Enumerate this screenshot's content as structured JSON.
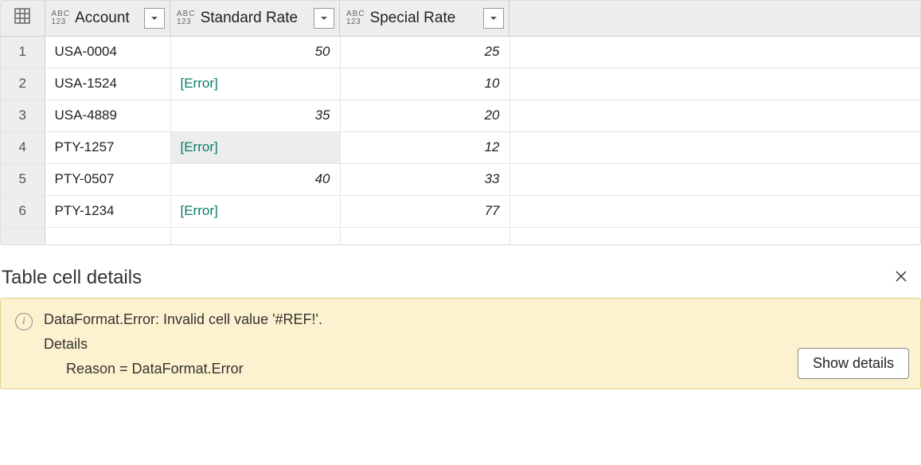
{
  "columns": {
    "c0": {
      "label": "Account",
      "type_top": "ABC",
      "type_bot": "123"
    },
    "c1": {
      "label": "Standard Rate",
      "type_top": "ABC",
      "type_bot": "123"
    },
    "c2": {
      "label": "Special Rate",
      "type_top": "ABC",
      "type_bot": "123"
    }
  },
  "rows": [
    {
      "n": "1",
      "account": "USA-0004",
      "std": "50",
      "std_err": false,
      "sp": "25"
    },
    {
      "n": "2",
      "account": "USA-1524",
      "std": "[Error]",
      "std_err": true,
      "sp": "10"
    },
    {
      "n": "3",
      "account": "USA-4889",
      "std": "35",
      "std_err": false,
      "sp": "20"
    },
    {
      "n": "4",
      "account": "PTY-1257",
      "std": "[Error]",
      "std_err": true,
      "sp": "12",
      "selected": true
    },
    {
      "n": "5",
      "account": "PTY-0507",
      "std": "40",
      "std_err": false,
      "sp": "33"
    },
    {
      "n": "6",
      "account": "PTY-1234",
      "std": "[Error]",
      "std_err": true,
      "sp": "77"
    }
  ],
  "details": {
    "title": "Table cell details",
    "error_line": "DataFormat.Error: Invalid cell value '#REF!'.",
    "details_label": "Details",
    "reason_line": "Reason = DataFormat.Error",
    "show_btn": "Show details"
  }
}
